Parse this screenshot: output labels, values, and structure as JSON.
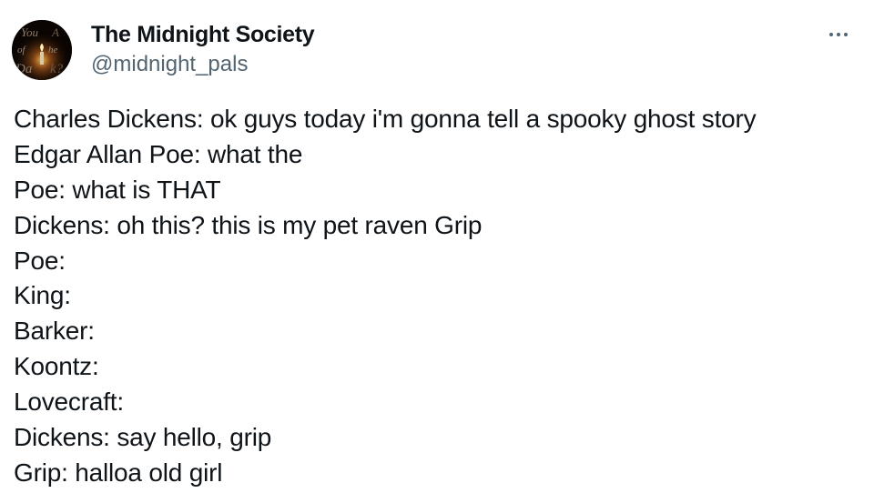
{
  "author": {
    "display_name": "The Midnight Society",
    "handle": "@midnight_pals",
    "avatar_text": "You Afraid of the Dark?"
  },
  "menu": {
    "icon": "more-horizontal-icon"
  },
  "tweet": {
    "lines": [
      "Charles Dickens: ok guys today i'm gonna tell a spooky ghost story",
      "Edgar Allan Poe: what the",
      "Poe: what is THAT",
      "Dickens: oh this? this is my pet raven Grip",
      "Poe:",
      "King:",
      "Barker:",
      "Koontz:",
      "Lovecraft:",
      "Dickens: say hello, grip",
      "Grip: halloa old girl"
    ]
  },
  "colors": {
    "text_primary": "#0f1419",
    "text_secondary": "#536471",
    "background": "#ffffff"
  }
}
